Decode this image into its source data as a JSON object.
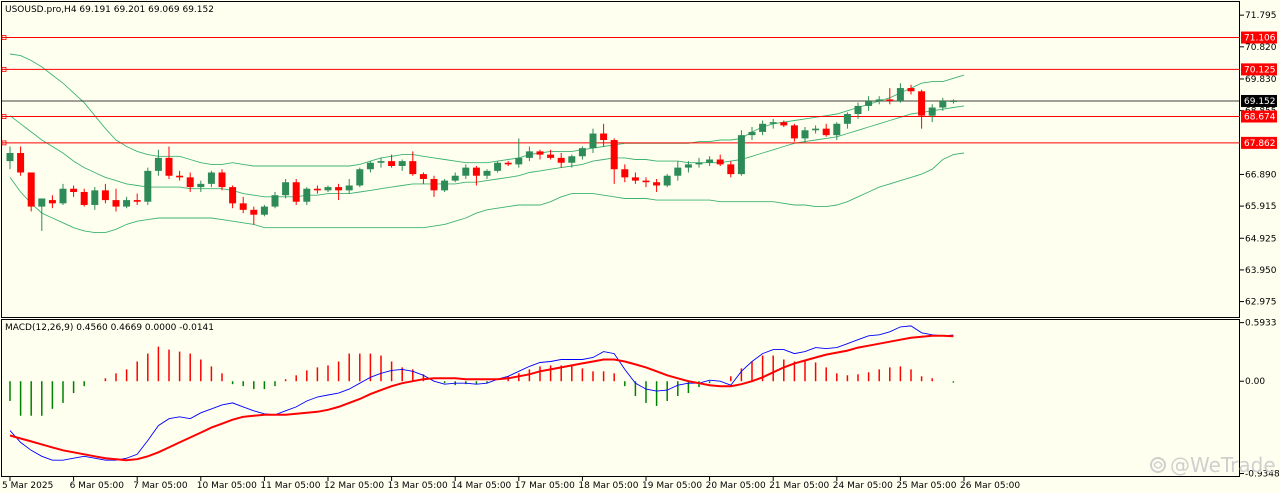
{
  "price_panel": {
    "header": "USOUSD.pro,H4  69.191 69.201 69.069 69.152",
    "ylim": [
      62.5,
      72.2
    ],
    "ticks": [
      "71.795",
      "70.820",
      "69.830",
      "68.855",
      "66.890",
      "65.915",
      "64.925",
      "63.950",
      "62.975"
    ],
    "current_price": "69.152",
    "current_price_value": 69.152,
    "hlines": [
      {
        "label": "71.106",
        "value": 71.106
      },
      {
        "label": "70.125",
        "value": 70.125
      },
      {
        "label": "68.674",
        "value": 68.674
      },
      {
        "label": "67.862",
        "value": 67.862
      }
    ],
    "colors": {
      "bull": "#2e8b57",
      "bear": "#ff0000",
      "band": "#3cb371",
      "hline": "#ff0000",
      "price_line": "#000000"
    }
  },
  "macd_panel": {
    "header": "MACD(12,26,9) 0.4560 0.4669 0.0000 -0.0141",
    "ylim": [
      -0.96,
      0.62
    ],
    "ticks": [
      "0.5933",
      "0.00",
      "-0.9348"
    ],
    "colors": {
      "hist_pos": "#ff0000",
      "hist_neg": "#008000",
      "macd": "#0000ff",
      "signal": "#ff0000"
    }
  },
  "x_axis": {
    "labels": [
      "5 Mar 2025",
      "6 Mar 05:00",
      "7 Mar 05:00",
      "10 Mar 05:00",
      "11 Mar 05:00",
      "12 Mar 05:00",
      "13 Mar 05:00",
      "14 Mar 05:00",
      "17 Mar 05:00",
      "18 Mar 05:00",
      "19 Mar 05:00",
      "20 Mar 05:00",
      "21 Mar 05:00",
      "24 Mar 05:00",
      "25 Mar 05:00",
      "26 Mar 05:00"
    ],
    "label_bars": [
      0,
      6,
      12,
      18,
      24,
      30,
      36,
      42,
      48,
      54,
      60,
      66,
      72,
      78,
      84,
      90
    ]
  },
  "watermark": "@WeTrade",
  "chart_data": [
    {
      "type": "candlestick",
      "title": "USOUSD.pro,H4",
      "x_labels": [
        "5 Mar 2025",
        "6 Mar 05:00",
        "7 Mar 05:00",
        "10 Mar 05:00",
        "11 Mar 05:00",
        "12 Mar 05:00",
        "13 Mar 05:00",
        "14 Mar 05:00",
        "17 Mar 05:00",
        "18 Mar 05:00",
        "19 Mar 05:00",
        "20 Mar 05:00",
        "21 Mar 05:00",
        "24 Mar 05:00",
        "25 Mar 05:00",
        "26 Mar 05:00"
      ],
      "ohlc": [
        [
          67.3,
          67.75,
          67.05,
          67.55
        ],
        [
          67.55,
          67.75,
          66.85,
          66.95
        ],
        [
          66.95,
          66.95,
          65.75,
          65.9
        ],
        [
          65.9,
          66.1,
          65.15,
          66.15
        ],
        [
          66.1,
          66.25,
          65.85,
          66.0
        ],
        [
          66.0,
          66.6,
          65.95,
          66.45
        ],
        [
          66.45,
          66.55,
          66.2,
          66.35
        ],
        [
          66.35,
          66.45,
          65.9,
          65.95
        ],
        [
          65.95,
          66.5,
          65.8,
          66.4
        ],
        [
          66.4,
          66.6,
          66.0,
          66.1
        ],
        [
          66.1,
          66.45,
          65.75,
          65.9
        ],
        [
          65.9,
          66.2,
          65.85,
          66.1
        ],
        [
          66.1,
          66.3,
          65.95,
          66.05
        ],
        [
          66.05,
          67.1,
          65.95,
          67.0
        ],
        [
          67.0,
          67.65,
          66.85,
          67.4
        ],
        [
          67.4,
          67.75,
          66.75,
          66.85
        ],
        [
          66.85,
          67.0,
          66.7,
          66.8
        ],
        [
          66.8,
          66.95,
          66.35,
          66.5
        ],
        [
          66.5,
          66.7,
          66.35,
          66.6
        ],
        [
          66.6,
          67.0,
          66.5,
          66.95
        ],
        [
          66.95,
          67.05,
          66.4,
          66.5
        ],
        [
          66.5,
          66.55,
          65.85,
          66.0
        ],
        [
          66.0,
          66.2,
          65.7,
          65.8
        ],
        [
          65.8,
          65.9,
          65.35,
          65.65
        ],
        [
          65.65,
          65.95,
          65.6,
          65.9
        ],
        [
          65.9,
          66.35,
          65.85,
          66.25
        ],
        [
          66.25,
          66.75,
          66.15,
          66.65
        ],
        [
          66.65,
          66.75,
          65.95,
          66.05
        ],
        [
          66.05,
          66.5,
          65.95,
          66.45
        ],
        [
          66.45,
          66.55,
          66.3,
          66.4
        ],
        [
          66.4,
          66.55,
          66.35,
          66.5
        ],
        [
          66.5,
          66.6,
          66.1,
          66.4
        ],
        [
          66.4,
          66.75,
          66.3,
          66.55
        ],
        [
          66.55,
          67.1,
          66.5,
          67.05
        ],
        [
          67.05,
          67.3,
          66.95,
          67.25
        ],
        [
          67.25,
          67.4,
          67.1,
          67.3
        ],
        [
          67.3,
          67.5,
          67.1,
          67.15
        ],
        [
          67.15,
          67.35,
          67.0,
          67.3
        ],
        [
          67.3,
          67.6,
          66.85,
          66.9
        ],
        [
          66.9,
          66.95,
          66.6,
          66.75
        ],
        [
          66.75,
          66.85,
          66.2,
          66.4
        ],
        [
          66.4,
          66.75,
          66.35,
          66.7
        ],
        [
          66.7,
          66.95,
          66.65,
          66.85
        ],
        [
          66.85,
          67.2,
          66.75,
          67.1
        ],
        [
          67.1,
          67.15,
          66.55,
          66.85
        ],
        [
          66.85,
          67.05,
          66.75,
          67.0
        ],
        [
          67.0,
          67.3,
          66.95,
          67.25
        ],
        [
          67.25,
          67.3,
          67.15,
          67.2
        ],
        [
          67.2,
          68.0,
          67.1,
          67.4
        ],
        [
          67.4,
          67.75,
          67.3,
          67.6
        ],
        [
          67.6,
          67.65,
          67.35,
          67.5
        ],
        [
          67.5,
          67.65,
          67.35,
          67.4
        ],
        [
          67.4,
          67.55,
          67.1,
          67.25
        ],
        [
          67.25,
          67.5,
          67.1,
          67.45
        ],
        [
          67.45,
          67.75,
          67.35,
          67.7
        ],
        [
          67.7,
          68.3,
          67.55,
          68.15
        ],
        [
          68.15,
          68.45,
          67.75,
          67.95
        ],
        [
          67.95,
          68.0,
          66.6,
          67.05
        ],
        [
          67.05,
          67.2,
          66.65,
          66.8
        ],
        [
          66.8,
          66.95,
          66.6,
          66.7
        ],
        [
          66.7,
          66.8,
          66.5,
          66.65
        ],
        [
          66.65,
          66.75,
          66.35,
          66.55
        ],
        [
          66.55,
          66.9,
          66.5,
          66.85
        ],
        [
          66.85,
          67.3,
          66.7,
          67.1
        ],
        [
          67.1,
          67.3,
          66.95,
          67.2
        ],
        [
          67.2,
          67.4,
          67.1,
          67.25
        ],
        [
          67.25,
          67.45,
          67.15,
          67.35
        ],
        [
          67.35,
          67.5,
          67.15,
          67.2
        ],
        [
          67.2,
          67.3,
          66.8,
          66.9
        ],
        [
          66.9,
          68.25,
          66.85,
          68.1
        ],
        [
          68.1,
          68.35,
          67.95,
          68.2
        ],
        [
          68.2,
          68.55,
          68.1,
          68.45
        ],
        [
          68.45,
          68.6,
          68.3,
          68.5
        ],
        [
          68.5,
          68.55,
          68.35,
          68.4
        ],
        [
          68.4,
          68.45,
          67.9,
          68.0
        ],
        [
          68.0,
          68.35,
          67.85,
          68.25
        ],
        [
          68.25,
          68.4,
          68.15,
          68.3
        ],
        [
          68.3,
          68.45,
          68.05,
          68.1
        ],
        [
          68.1,
          68.5,
          67.95,
          68.45
        ],
        [
          68.45,
          68.8,
          68.3,
          68.75
        ],
        [
          68.75,
          69.1,
          68.6,
          69.0
        ],
        [
          69.0,
          69.3,
          68.85,
          69.15
        ],
        [
          69.15,
          69.3,
          69.05,
          69.2
        ],
        [
          69.2,
          69.55,
          69.05,
          69.15
        ],
        [
          69.15,
          69.7,
          69.1,
          69.55
        ],
        [
          69.55,
          69.65,
          69.35,
          69.45
        ],
        [
          69.45,
          69.5,
          68.3,
          68.7
        ],
        [
          68.7,
          69.05,
          68.5,
          68.95
        ],
        [
          68.95,
          69.25,
          68.85,
          69.15
        ],
        [
          69.15,
          69.2,
          69.07,
          69.152
        ]
      ],
      "bollinger": {
        "upper": [
          70.6,
          70.55,
          70.4,
          70.2,
          69.95,
          69.7,
          69.4,
          69.1,
          68.7,
          68.3,
          67.95,
          67.75,
          67.6,
          67.5,
          67.45,
          67.45,
          67.45,
          67.35,
          67.25,
          67.2,
          67.2,
          67.25,
          67.2,
          67.15,
          67.15,
          67.15,
          67.15,
          67.15,
          67.15,
          67.15,
          67.15,
          67.15,
          67.15,
          67.2,
          67.3,
          67.4,
          67.45,
          67.5,
          67.5,
          67.45,
          67.4,
          67.35,
          67.3,
          67.25,
          67.25,
          67.25,
          67.3,
          67.35,
          67.4,
          67.5,
          67.55,
          67.6,
          67.6,
          67.6,
          67.65,
          67.7,
          67.75,
          67.8,
          67.85,
          67.85,
          67.85,
          67.85,
          67.85,
          67.85,
          67.85,
          67.9,
          67.9,
          67.95,
          67.95,
          68.0,
          68.2,
          68.35,
          68.45,
          68.5,
          68.55,
          68.6,
          68.65,
          68.7,
          68.75,
          68.85,
          68.95,
          69.05,
          69.15,
          69.25,
          69.4,
          69.55,
          69.7,
          69.75,
          69.75,
          69.85,
          69.95
        ],
        "middle": [
          68.7,
          68.45,
          68.2,
          67.95,
          67.75,
          67.55,
          67.3,
          67.1,
          66.95,
          66.8,
          66.7,
          66.6,
          66.55,
          66.5,
          66.5,
          66.5,
          66.5,
          66.45,
          66.45,
          66.45,
          66.45,
          66.4,
          66.3,
          66.25,
          66.2,
          66.2,
          66.2,
          66.2,
          66.25,
          66.25,
          66.3,
          66.3,
          66.3,
          66.35,
          66.4,
          66.45,
          66.5,
          66.55,
          66.6,
          66.6,
          66.6,
          66.6,
          66.6,
          66.65,
          66.65,
          66.7,
          66.75,
          66.8,
          66.85,
          66.95,
          67.0,
          67.05,
          67.1,
          67.15,
          67.2,
          67.3,
          67.35,
          67.4,
          67.4,
          67.35,
          67.35,
          67.3,
          67.3,
          67.3,
          67.25,
          67.25,
          67.25,
          67.25,
          67.3,
          67.35,
          67.45,
          67.55,
          67.65,
          67.75,
          67.85,
          67.9,
          67.95,
          68.0,
          68.05,
          68.15,
          68.25,
          68.35,
          68.45,
          68.55,
          68.65,
          68.75,
          68.8,
          68.85,
          68.9,
          68.95,
          69.0
        ],
        "lower": [
          66.8,
          66.35,
          66.0,
          65.7,
          65.55,
          65.4,
          65.25,
          65.15,
          65.1,
          65.1,
          65.2,
          65.35,
          65.45,
          65.5,
          65.55,
          65.55,
          65.55,
          65.55,
          65.55,
          65.55,
          65.5,
          65.45,
          65.4,
          65.35,
          65.25,
          65.25,
          65.25,
          65.25,
          65.25,
          65.25,
          65.25,
          65.25,
          65.25,
          65.25,
          65.25,
          65.25,
          65.25,
          65.25,
          65.25,
          65.25,
          65.3,
          65.35,
          65.45,
          65.55,
          65.7,
          65.8,
          65.85,
          65.9,
          65.95,
          65.95,
          65.95,
          66.05,
          66.2,
          66.3,
          66.3,
          66.3,
          66.25,
          66.2,
          66.15,
          66.15,
          66.15,
          66.1,
          66.1,
          66.1,
          66.1,
          66.1,
          66.1,
          66.05,
          66.05,
          66.05,
          66.05,
          66.05,
          66.05,
          66.0,
          65.95,
          65.95,
          65.9,
          65.9,
          65.95,
          66.05,
          66.2,
          66.35,
          66.5,
          66.6,
          66.7,
          66.8,
          66.9,
          67.05,
          67.35,
          67.5,
          67.55
        ]
      }
    },
    {
      "type": "line",
      "title": "MACD(12,26,9)",
      "ylim": [
        -0.9348,
        0.5933
      ],
      "series": [
        {
          "name": "MACD",
          "values": [
            -0.5,
            -0.62,
            -0.7,
            -0.76,
            -0.8,
            -0.8,
            -0.78,
            -0.76,
            -0.78,
            -0.8,
            -0.8,
            -0.78,
            -0.74,
            -0.6,
            -0.45,
            -0.38,
            -0.36,
            -0.38,
            -0.32,
            -0.28,
            -0.24,
            -0.22,
            -0.26,
            -0.3,
            -0.33,
            -0.34,
            -0.3,
            -0.26,
            -0.2,
            -0.16,
            -0.14,
            -0.12,
            -0.08,
            -0.02,
            0.04,
            0.08,
            0.11,
            0.12,
            0.1,
            0.06,
            0.0,
            -0.03,
            -0.02,
            -0.02,
            -0.03,
            -0.02,
            0.02,
            0.05,
            0.1,
            0.15,
            0.19,
            0.2,
            0.22,
            0.22,
            0.22,
            0.24,
            0.3,
            0.28,
            0.12,
            -0.02,
            -0.08,
            -0.1,
            -0.09,
            -0.04,
            -0.02,
            -0.02,
            0.01,
            0.0,
            -0.04,
            0.1,
            0.2,
            0.28,
            0.32,
            0.32,
            0.28,
            0.3,
            0.34,
            0.33,
            0.34,
            0.38,
            0.42,
            0.46,
            0.47,
            0.5,
            0.55,
            0.56,
            0.49,
            0.47,
            0.46,
            0.4669
          ]
        },
        {
          "name": "Signal",
          "values": [
            -0.55,
            -0.58,
            -0.61,
            -0.64,
            -0.67,
            -0.7,
            -0.72,
            -0.74,
            -0.76,
            -0.78,
            -0.79,
            -0.8,
            -0.79,
            -0.76,
            -0.72,
            -0.67,
            -0.62,
            -0.57,
            -0.52,
            -0.47,
            -0.43,
            -0.39,
            -0.36,
            -0.35,
            -0.34,
            -0.34,
            -0.34,
            -0.33,
            -0.32,
            -0.31,
            -0.29,
            -0.26,
            -0.22,
            -0.18,
            -0.13,
            -0.09,
            -0.05,
            -0.02,
            0.0,
            0.02,
            0.03,
            0.03,
            0.03,
            0.02,
            0.02,
            0.02,
            0.02,
            0.03,
            0.05,
            0.07,
            0.1,
            0.12,
            0.14,
            0.16,
            0.18,
            0.2,
            0.22,
            0.22,
            0.2,
            0.17,
            0.14,
            0.1,
            0.06,
            0.03,
            0.0,
            -0.02,
            -0.04,
            -0.05,
            -0.05,
            -0.03,
            0.0,
            0.04,
            0.09,
            0.14,
            0.18,
            0.21,
            0.24,
            0.27,
            0.29,
            0.31,
            0.34,
            0.36,
            0.38,
            0.4,
            0.42,
            0.44,
            0.45,
            0.46,
            0.46,
            0.456
          ]
        },
        {
          "name": "Histogram",
          "values": [
            -0.2,
            -0.35,
            -0.35,
            -0.35,
            -0.28,
            -0.22,
            -0.12,
            -0.05,
            0.0,
            0.03,
            0.08,
            0.12,
            0.2,
            0.28,
            0.35,
            0.32,
            0.3,
            0.28,
            0.22,
            0.15,
            0.08,
            -0.03,
            -0.05,
            -0.08,
            -0.08,
            -0.05,
            0.02,
            0.06,
            0.11,
            0.14,
            0.16,
            0.2,
            0.28,
            0.28,
            0.28,
            0.26,
            0.2,
            0.14,
            0.12,
            0.07,
            0.0,
            -0.02,
            -0.04,
            -0.03,
            -0.03,
            -0.02,
            0.0,
            0.05,
            0.08,
            0.12,
            0.15,
            0.16,
            0.16,
            0.16,
            0.13,
            0.1,
            0.1,
            0.08,
            -0.05,
            -0.15,
            -0.22,
            -0.25,
            -0.2,
            -0.15,
            -0.12,
            -0.06,
            -0.02,
            0.0,
            0.05,
            0.13,
            0.2,
            0.26,
            0.26,
            0.22,
            0.2,
            0.2,
            0.19,
            0.14,
            0.08,
            0.06,
            0.07,
            0.09,
            0.12,
            0.14,
            0.15,
            0.12,
            0.05,
            0.03,
            0.0,
            -0.0141
          ]
        }
      ]
    }
  ]
}
